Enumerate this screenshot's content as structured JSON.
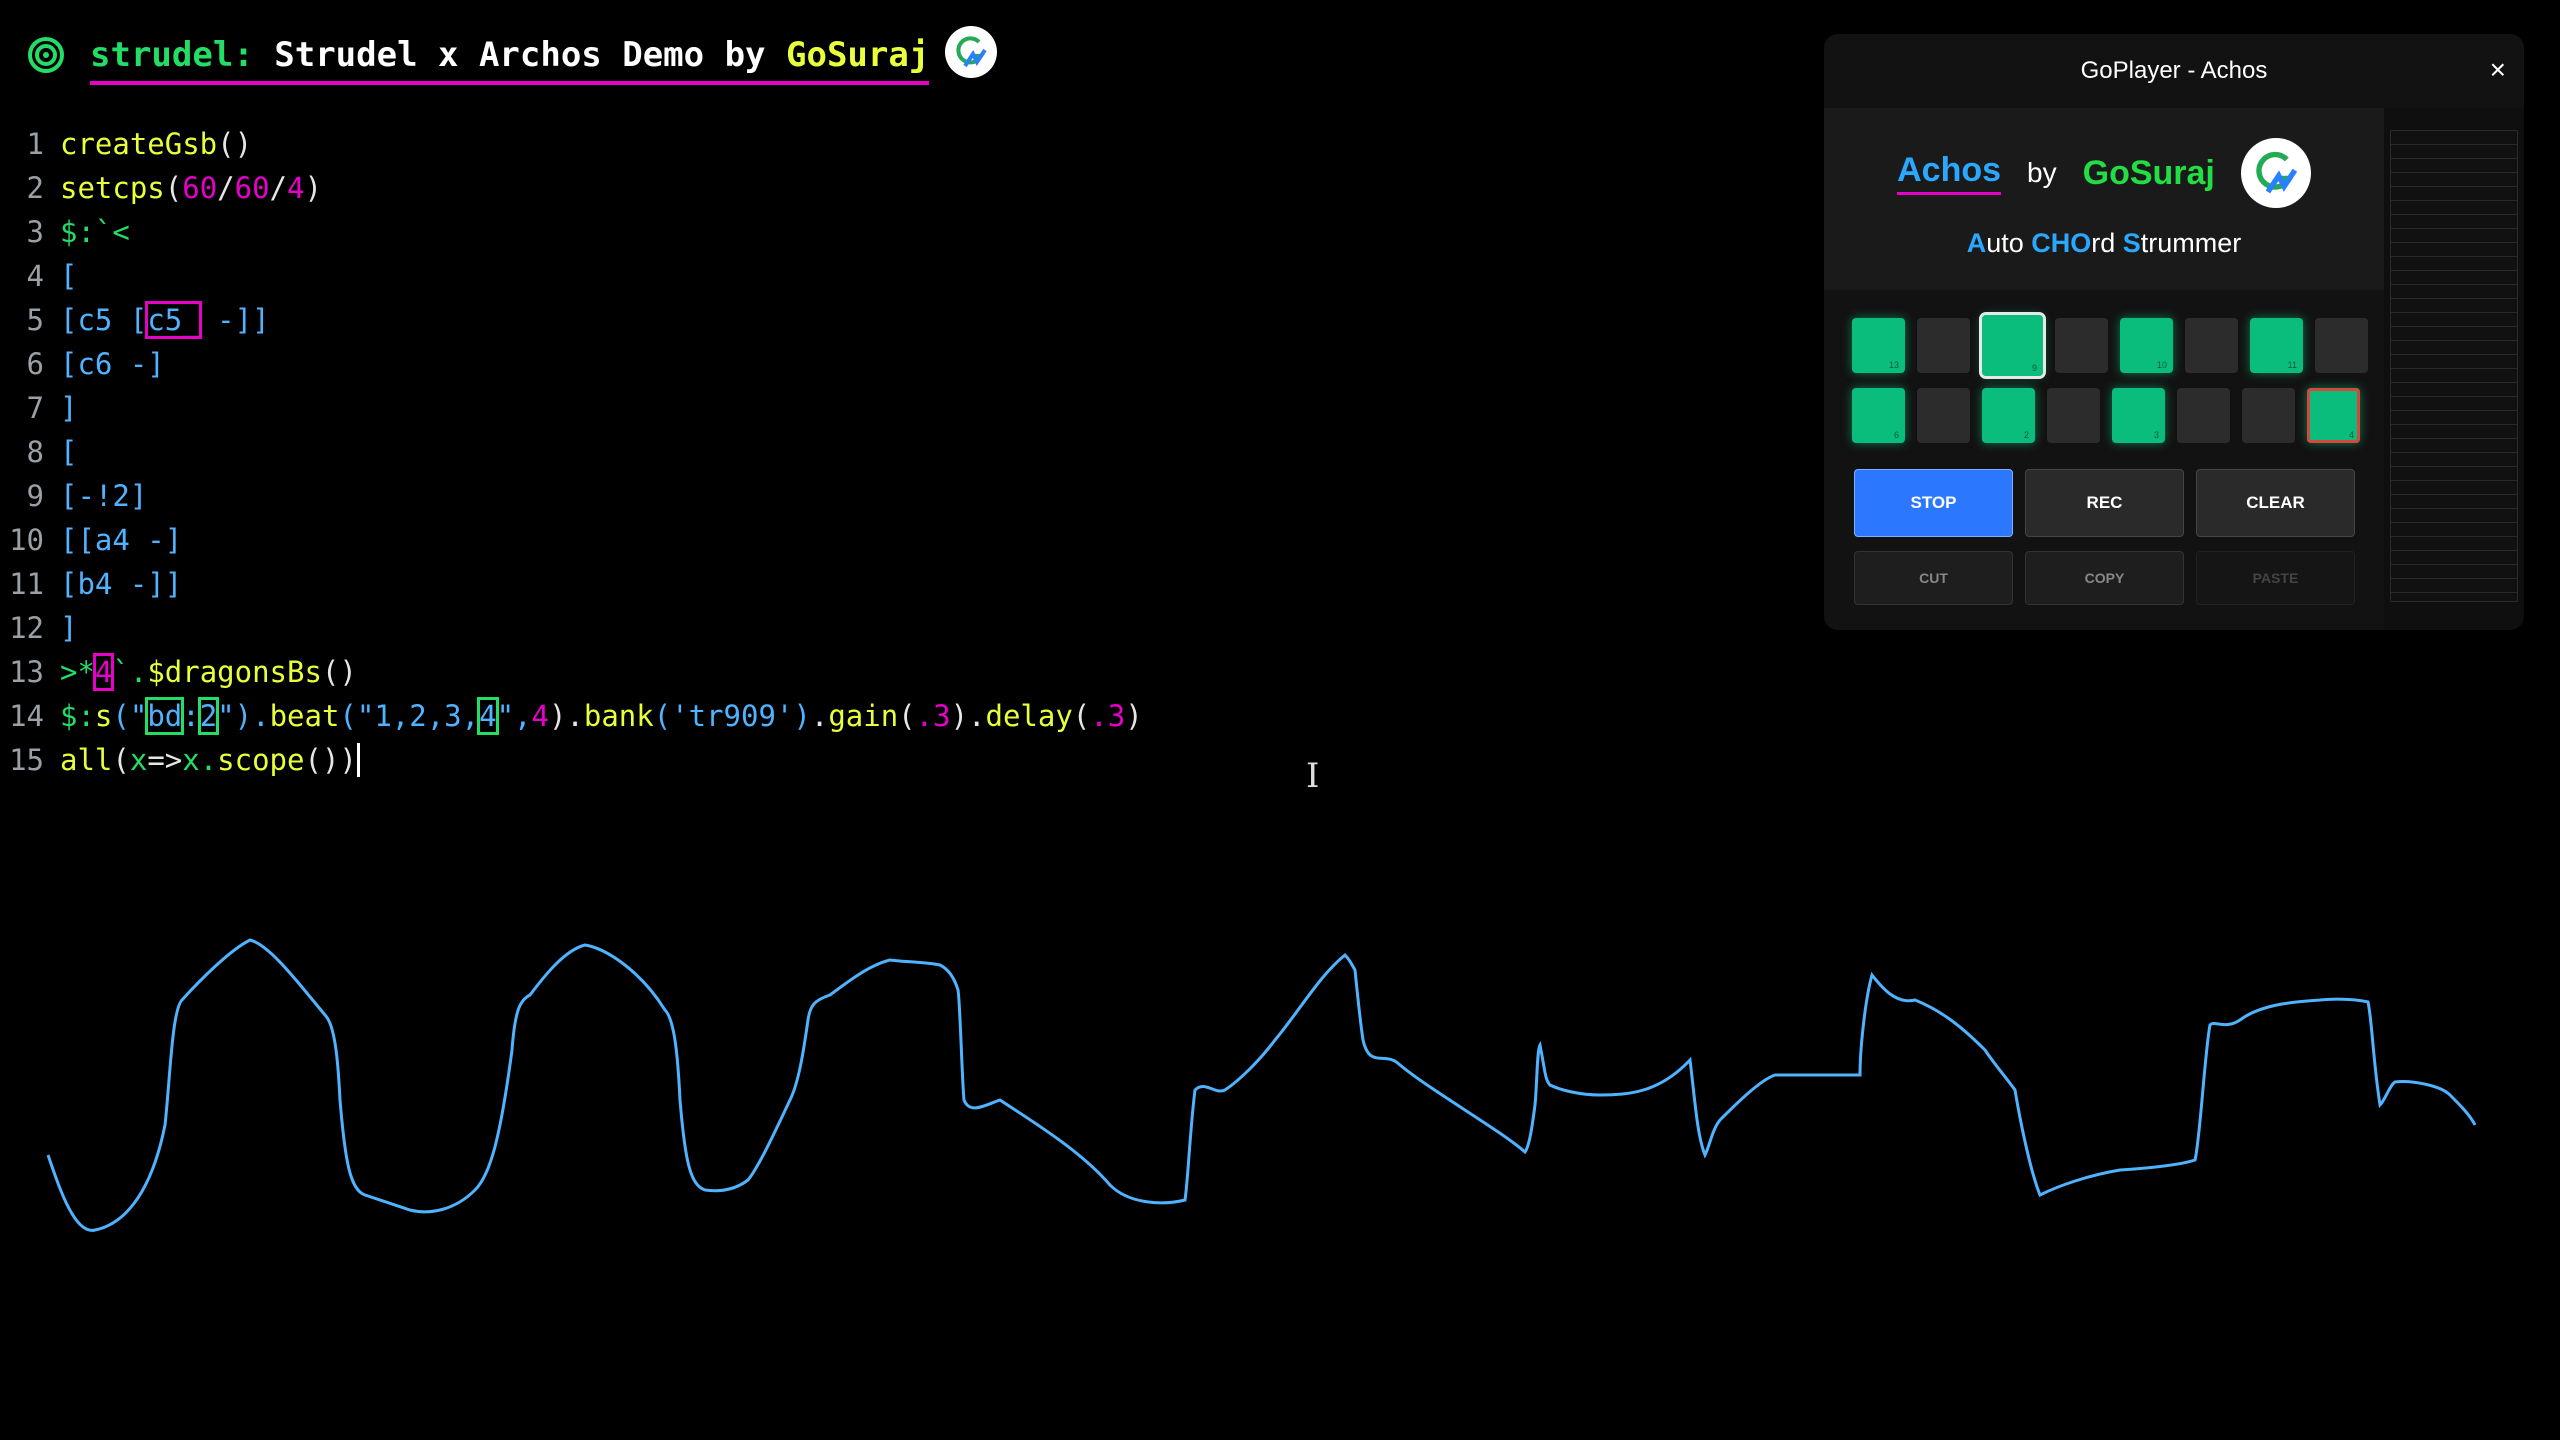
{
  "header": {
    "prefix": "strudel:",
    "title_main": "Strudel x Archos Demo by ",
    "title_author": "GoSuraj"
  },
  "editor": {
    "lines": [
      {
        "n": "1"
      },
      {
        "n": "2"
      },
      {
        "n": "3"
      },
      {
        "n": "4"
      },
      {
        "n": "5"
      },
      {
        "n": "6"
      },
      {
        "n": "7"
      },
      {
        "n": "8"
      },
      {
        "n": "9"
      },
      {
        "n": "10"
      },
      {
        "n": "11"
      },
      {
        "n": "12"
      },
      {
        "n": "13"
      },
      {
        "n": "14"
      },
      {
        "n": "15"
      }
    ],
    "l1": "createGsb",
    "l2_fn": "setcps",
    "l2_a": "60",
    "l2_b": "60",
    "l2_c": "4",
    "l3": "$:`<",
    "l4": "[",
    "l5_a": "[c5 [",
    "l5_box": "c5_",
    "l5_b": " -]]",
    "l6": "[c6 -]",
    "l7": "]",
    "l8": "[",
    "l9": "[-!2]",
    "l10": "[[a4 -]",
    "l11": "[b4 -]]",
    "l12": "]",
    "l13_a": ">*",
    "l13_num": "4",
    "l13_b": "`.",
    "l13_fn": "$dragonsBs",
    "l14_a": "$:",
    "l14_s": "s",
    "l14_q1": "(\"",
    "l14_box1": "bd",
    "l14_colon": ":",
    "l14_box2": "2",
    "l14_q2": "\").",
    "l14_beat": "beat",
    "l14_beatstr": "(\"1,2,3,",
    "l14_box3": "4",
    "l14_beatend": "\",",
    "l14_num4": "4",
    "l14_close": ").",
    "l14_bank": "bank",
    "l14_bankstr": "('tr909')",
    "l14_dot2": ".",
    "l14_gain": "gain",
    "l14_gv": ".3",
    "l14_dot3": ").",
    "l14_delay": "delay",
    "l14_dv": ".3",
    "l14_end": ")",
    "l15_fn": "all",
    "l15_x": "x",
    "l15_arrow": "=>",
    "l15_x2": "x.",
    "l15_scope": "scope",
    "l15_end": "())"
  },
  "goplayer": {
    "window_title": "GoPlayer - Achos",
    "close": "×",
    "brand": "Achos",
    "by": "by",
    "author": "GoSuraj",
    "subtitle_parts": [
      "A",
      "uto ",
      "CHO",
      "rd ",
      "S",
      "trummer"
    ],
    "pads_row1": [
      {
        "on": true,
        "n": "13"
      },
      {
        "on": false,
        "n": ""
      },
      {
        "on": true,
        "n": "9",
        "sel": true
      },
      {
        "on": false,
        "n": ""
      },
      {
        "on": true,
        "n": "10"
      },
      {
        "on": false,
        "n": ""
      },
      {
        "on": true,
        "n": "11"
      },
      {
        "on": false,
        "n": ""
      }
    ],
    "pads_row2": [
      {
        "on": true,
        "n": "6"
      },
      {
        "on": false,
        "n": ""
      },
      {
        "on": true,
        "n": "2"
      },
      {
        "on": false,
        "n": ""
      },
      {
        "on": true,
        "n": "3"
      },
      {
        "on": false,
        "n": ""
      },
      {
        "on": false,
        "n": ""
      },
      {
        "on": true,
        "n": "4",
        "red": true
      }
    ],
    "buttons": {
      "stop": "STOP",
      "rec": "REC",
      "clear": "CLEAR",
      "cut": "CUT",
      "copy": "COPY",
      "paste": "PASTE"
    }
  },
  "colors": {
    "accent_magenta": "#e600c8",
    "accent_green": "#22dd66",
    "accent_yellow": "#e8ff3a",
    "accent_blue": "#4fb3ff",
    "scope_color": "#4fb3ff",
    "pad_on": "#0bbd7c",
    "stop_button": "#2b78ff"
  }
}
